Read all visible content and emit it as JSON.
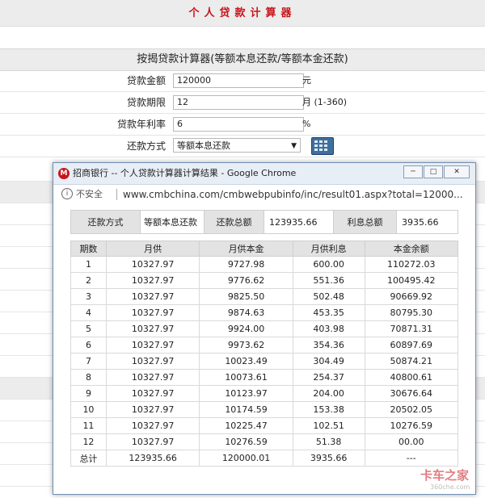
{
  "page": {
    "title": "个人贷款计算器",
    "section_title": "按揭贷款计算器(等额本息还款/等额本金还款)"
  },
  "form": {
    "amount": {
      "label": "贷款金额",
      "value": "120000",
      "unit": "元"
    },
    "term": {
      "label": "贷款期限",
      "value": "12",
      "unit": "月 (1-360)"
    },
    "rate": {
      "label": "贷款年利率",
      "value": "6",
      "unit": "%"
    },
    "method": {
      "label": "还款方式",
      "value": "等额本息还款"
    },
    "calculator_icon": "calculator-icon"
  },
  "popup": {
    "title": "招商银行 -- 个人贷款计算器计算结果 - Google Chrome",
    "logo_icon": "cmb-logo-icon",
    "insecure_label": "不安全",
    "url": "www.cmbchina.com/cmbwebpubinfo/inc/result01.aspx?total=12000...",
    "summary": {
      "method_label": "还款方式",
      "method_value": "等额本息还款",
      "total_label": "还款总额",
      "total_value": "123935.66",
      "interest_label": "利息总额",
      "interest_value": "3935.66"
    },
    "table": {
      "headers": [
        "期数",
        "月供",
        "月供本金",
        "月供利息",
        "本金余额"
      ],
      "rows": [
        [
          "1",
          "10327.97",
          "9727.98",
          "600.00",
          "110272.03"
        ],
        [
          "2",
          "10327.97",
          "9776.62",
          "551.36",
          "100495.42"
        ],
        [
          "3",
          "10327.97",
          "9825.50",
          "502.48",
          "90669.92"
        ],
        [
          "4",
          "10327.97",
          "9874.63",
          "453.35",
          "80795.30"
        ],
        [
          "5",
          "10327.97",
          "9924.00",
          "403.98",
          "70871.31"
        ],
        [
          "6",
          "10327.97",
          "9973.62",
          "354.36",
          "60897.69"
        ],
        [
          "7",
          "10327.97",
          "10023.49",
          "304.49",
          "50874.21"
        ],
        [
          "8",
          "10327.97",
          "10073.61",
          "254.37",
          "40800.61"
        ],
        [
          "9",
          "10327.97",
          "10123.97",
          "204.00",
          "30676.64"
        ],
        [
          "10",
          "10327.97",
          "10174.59",
          "153.38",
          "20502.05"
        ],
        [
          "11",
          "10327.97",
          "10225.47",
          "102.51",
          "10276.59"
        ],
        [
          "12",
          "10327.97",
          "10276.59",
          "51.38",
          "00.00"
        ],
        [
          "总计",
          "123935.66",
          "120000.01",
          "3935.66",
          "---"
        ]
      ]
    }
  },
  "watermark": {
    "text": "卡车之家",
    "sub": "360che.com"
  },
  "colors": {
    "title_red": "#c9141b",
    "header_gray": "#ececec"
  }
}
